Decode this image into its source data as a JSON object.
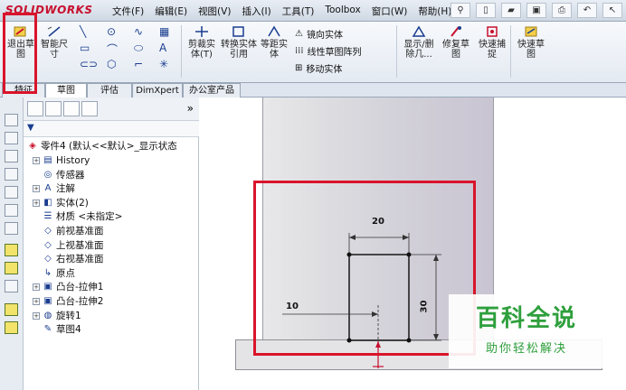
{
  "app": {
    "logo": "SOLIDWORKS"
  },
  "menu": [
    "文件(F)",
    "编辑(E)",
    "视图(V)",
    "插入(I)",
    "工具(T)",
    "Toolbox",
    "窗口(W)",
    "帮助(H)"
  ],
  "ribbon": {
    "exit_sketch": "退出草图",
    "smart_dimension": "智能尺寸",
    "trim": "剪裁实体(T)",
    "convert": "转换实体引用",
    "offset": "等距实体",
    "mirror": "镜向实体",
    "linear_pattern": "线性草图阵列",
    "move": "移动实体",
    "display_delete": "显示/删除几...",
    "repair": "修复草图",
    "quick_snap": "快速捕捉",
    "rapid_sketch": "快速草图"
  },
  "tabs": [
    "特征",
    "草图",
    "评估",
    "DimXpert",
    "办公室产品"
  ],
  "tree": {
    "root": "零件4 (默认<<默认>_显示状态",
    "items": [
      {
        "label": "History",
        "expandable": true
      },
      {
        "label": "传感器",
        "expandable": false
      },
      {
        "label": "注解",
        "expandable": true
      },
      {
        "label": "实体(2)",
        "expandable": true
      },
      {
        "label": "材质 <未指定>",
        "expandable": false
      },
      {
        "label": "前视基准面",
        "expandable": false
      },
      {
        "label": "上视基准面",
        "expandable": false
      },
      {
        "label": "右视基准面",
        "expandable": false
      },
      {
        "label": "原点",
        "expandable": false
      },
      {
        "label": "凸台-拉伸1",
        "expandable": true
      },
      {
        "label": "凸台-拉伸2",
        "expandable": true
      },
      {
        "label": "旋转1",
        "expandable": true
      },
      {
        "label": "草图4",
        "expandable": false
      }
    ]
  },
  "sketch": {
    "dim_width": "20",
    "dim_height": "30",
    "dim_offset": "10"
  },
  "watermark": {
    "title": "百科全说",
    "subtitle": "助你轻松解决"
  },
  "colors": {
    "highlight": "#d9142b",
    "watermark": "#2e9f3c"
  }
}
